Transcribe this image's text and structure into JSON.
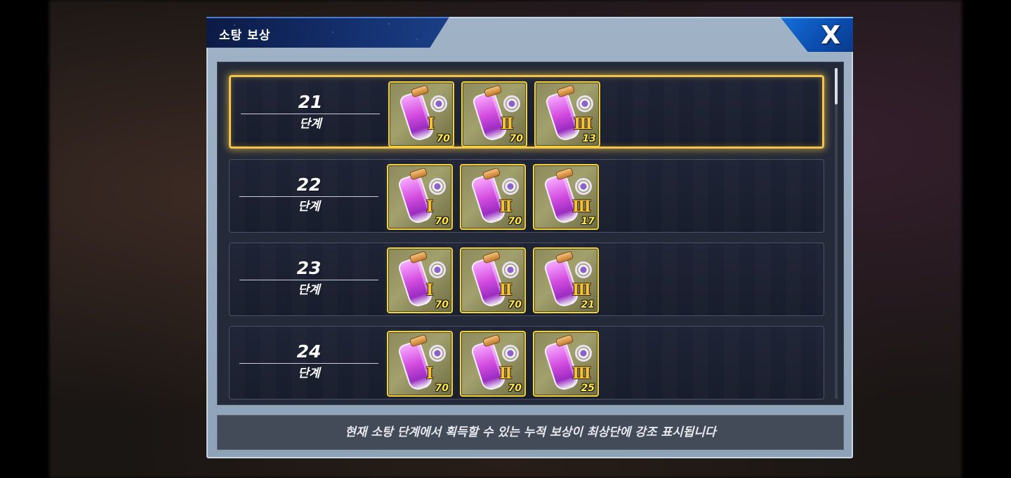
{
  "dialog": {
    "title": "소탕 보상",
    "close_label": "X",
    "footer_text": "현재 소탕 단계에서 획득할 수 있는 누적 보상이 최상단에 강조 표시됩니다"
  },
  "rows": [
    {
      "stage": "21",
      "stage_label": "단계",
      "highlighted": true,
      "items": [
        {
          "icon": "purple-potion-icon",
          "tier": "I",
          "qty": "70"
        },
        {
          "icon": "purple-potion-icon",
          "tier": "II",
          "qty": "70"
        },
        {
          "icon": "purple-potion-icon",
          "tier": "III",
          "qty": "13"
        }
      ]
    },
    {
      "stage": "22",
      "stage_label": "단계",
      "highlighted": false,
      "items": [
        {
          "icon": "purple-potion-icon",
          "tier": "I",
          "qty": "70"
        },
        {
          "icon": "purple-potion-icon",
          "tier": "II",
          "qty": "70"
        },
        {
          "icon": "purple-potion-icon",
          "tier": "III",
          "qty": "17"
        }
      ]
    },
    {
      "stage": "23",
      "stage_label": "단계",
      "highlighted": false,
      "items": [
        {
          "icon": "purple-potion-icon",
          "tier": "I",
          "qty": "70"
        },
        {
          "icon": "purple-potion-icon",
          "tier": "II",
          "qty": "70"
        },
        {
          "icon": "purple-potion-icon",
          "tier": "III",
          "qty": "21"
        }
      ]
    },
    {
      "stage": "24",
      "stage_label": "단계",
      "highlighted": false,
      "items": [
        {
          "icon": "purple-potion-icon",
          "tier": "I",
          "qty": "70"
        },
        {
          "icon": "purple-potion-icon",
          "tier": "II",
          "qty": "70"
        },
        {
          "icon": "purple-potion-icon",
          "tier": "III",
          "qty": "25"
        }
      ]
    }
  ],
  "colors": {
    "highlight_border": "#f3c34a",
    "item_border": "#f2d23c",
    "quantity_text": "#ffe94a",
    "title_tab": "#14306e",
    "close_button": "#0b4fb3"
  }
}
